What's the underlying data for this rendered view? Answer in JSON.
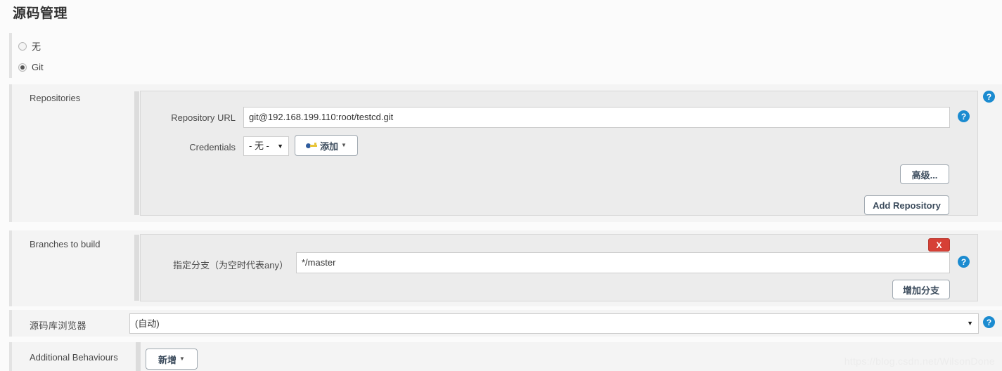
{
  "page": {
    "title": "源码管理",
    "watermark": "https://blog.csdn.net/WilsonDone"
  },
  "scm_type": {
    "options": [
      {
        "label": "无",
        "selected": false
      },
      {
        "label": "Git",
        "selected": true
      }
    ]
  },
  "repositories": {
    "section_label": "Repositories",
    "repository_url": {
      "label": "Repository URL",
      "value": "git@192.168.199.110:root/testcd.git",
      "help": "?"
    },
    "credentials": {
      "label": "Credentials",
      "selected": "- 无 -",
      "caret": "▼",
      "add_button": "添加",
      "add_caret": "▼"
    },
    "advanced_button": "高级...",
    "add_repository_button": "Add Repository",
    "help": "?"
  },
  "branches": {
    "section_label": "Branches to build",
    "branch_specifier": {
      "label": "指定分支（为空时代表any）",
      "value": "*/master",
      "delete_button": "X",
      "help": "?"
    },
    "add_branch_button": "增加分支"
  },
  "repository_browser": {
    "label": "源码库浏览器",
    "selected": "(自动)",
    "caret": "▼",
    "help": "?"
  },
  "additional_behaviours": {
    "label": "Additional Behaviours",
    "add_button": "新增",
    "add_caret": "▼"
  },
  "colors": {
    "help_blue": "#1b8bd0",
    "delete_red": "#d64036",
    "panel_bg": "#ececec",
    "row_bg": "#f4f4f4"
  }
}
